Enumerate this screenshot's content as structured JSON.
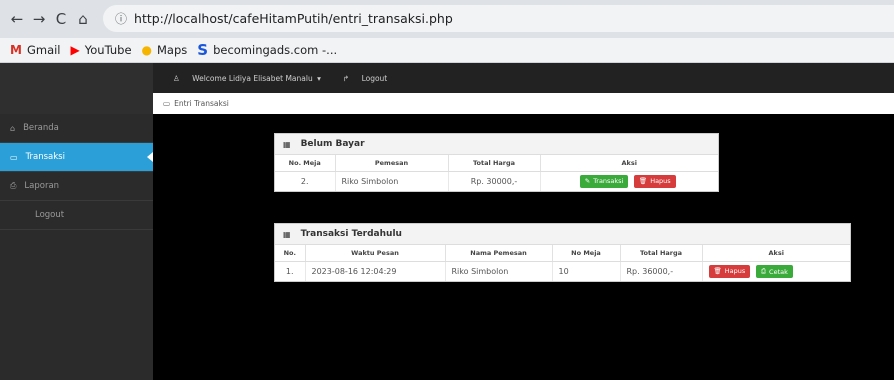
{
  "browser": {
    "url": "http://localhost/cafeHitamPutih/entri_transaksi.php",
    "bookmarks": [
      {
        "label": "Gmail",
        "icon": "gmail-icon"
      },
      {
        "label": "YouTube",
        "icon": "youtube-icon"
      },
      {
        "label": "Maps",
        "icon": "maps-icon"
      },
      {
        "label": "becomingads.com -...",
        "icon": "becomingads-icon"
      }
    ]
  },
  "topbar": {
    "welcome": "Welcome Lidiya Elisabet Manalu",
    "logout": "Logout"
  },
  "breadcrumb": "Entri Transaksi",
  "sidebar": {
    "items": [
      {
        "label": "Beranda"
      },
      {
        "label": "Transaksi"
      },
      {
        "label": "Laporan"
      },
      {
        "label": "Logout"
      }
    ]
  },
  "belum_bayar": {
    "title": "Belum Bayar",
    "columns": [
      "No. Meja",
      "Pemesan",
      "Total Harga",
      "Aksi"
    ],
    "rows": [
      {
        "no_meja": "2.",
        "pemesan": "Riko Simbolon",
        "total": "Rp. 30000,-"
      }
    ],
    "btn_transaksi": "Transaksi",
    "btn_hapus": "Hapus"
  },
  "transaksi_terdahulu": {
    "title": "Transaksi Terdahulu",
    "columns": [
      "No.",
      "Waktu Pesan",
      "Nama Pemesan",
      "No Meja",
      "Total Harga",
      "Aksi"
    ],
    "rows": [
      {
        "no": "1.",
        "waktu": "2023-08-16 12:04:29",
        "nama": "Riko Simbolon",
        "meja": "10",
        "total": "Rp. 36000,-"
      }
    ],
    "btn_hapus": "Hapus",
    "btn_cetak": "Cetak"
  },
  "colors": {
    "sidebar_active": "#2a9fd8",
    "btn_green": "#3aaa3a",
    "btn_red": "#d63c3c"
  }
}
